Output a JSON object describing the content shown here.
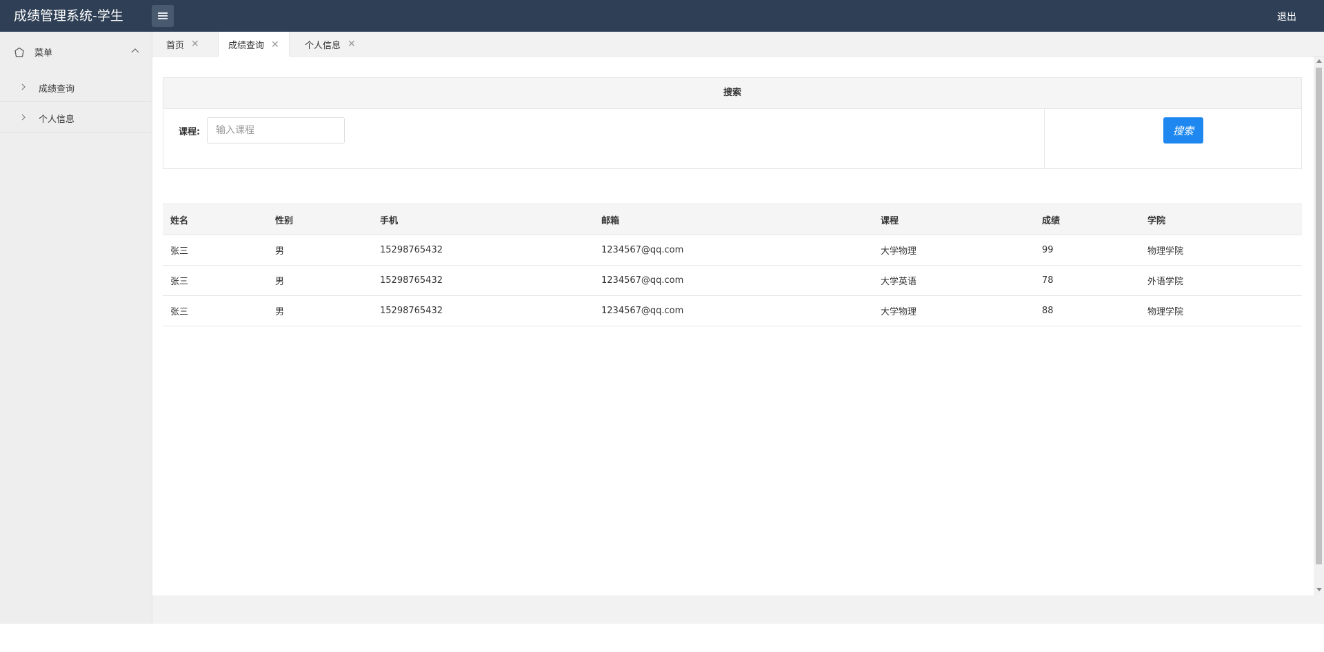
{
  "header": {
    "title": "成绩管理系统-学生",
    "logout_label": "退出"
  },
  "sidebar": {
    "menu_label": "菜单",
    "items": [
      {
        "label": "成绩查询"
      },
      {
        "label": "个人信息"
      }
    ]
  },
  "tabs": [
    {
      "label": "首页",
      "close": "✕"
    },
    {
      "label": "成绩查询",
      "close": "✕"
    },
    {
      "label": "个人信息",
      "close": "✕"
    }
  ],
  "search": {
    "heading": "搜索",
    "course_label": "课程:",
    "placeholder": "输入课程",
    "value": "",
    "button_label": "搜索"
  },
  "table": {
    "headers": [
      "姓名",
      "性别",
      "手机",
      "邮箱",
      "课程",
      "成绩",
      "学院"
    ],
    "rows": [
      [
        "张三",
        "男",
        "15298765432",
        "1234567@qq.com",
        "大学物理",
        "99",
        "物理学院"
      ],
      [
        "张三",
        "男",
        "15298765432",
        "1234567@qq.com",
        "大学英语",
        "78",
        "外语学院"
      ],
      [
        "张三",
        "男",
        "15298765432",
        "1234567@qq.com",
        "大学物理",
        "88",
        "物理学院"
      ]
    ]
  },
  "colors": {
    "topbar": "#2f4056",
    "primary_button": "#1e88f0",
    "sidebar_bg": "#eeeeee"
  }
}
